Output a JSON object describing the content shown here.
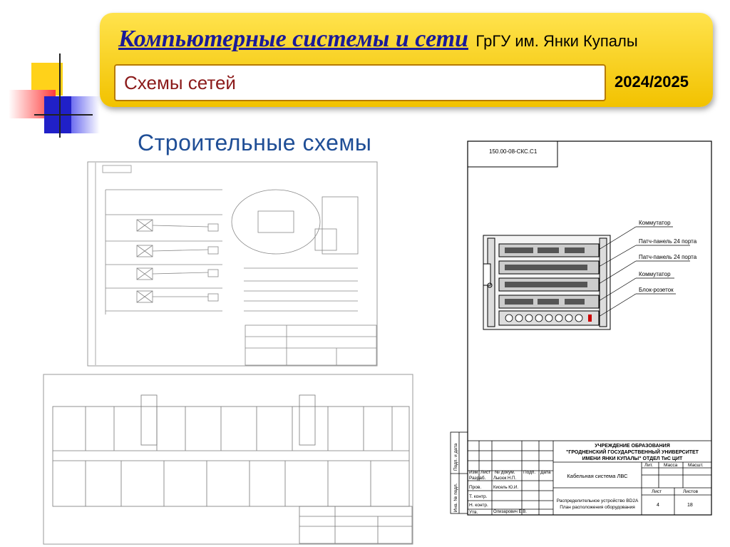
{
  "header": {
    "course_title": "Компьютерные системы и сети",
    "university": "ГрГУ им. Янки Купалы",
    "topic": "Схемы сетей",
    "year": "2024/2025"
  },
  "slide": {
    "title": "Строительные схемы"
  },
  "rack_drawing": {
    "doc_code": "150.00-08-СКС.С1",
    "callouts": [
      "Коммутатор",
      "Патч-панель 24 порта",
      "Патч-панель 24 порта",
      "Коммутатор",
      "Блок-розеток"
    ],
    "stamp": {
      "org_line1": "УЧРЕЖДЕНИЕ ОБРАЗОВАНИЯ",
      "org_line2": "\"ГРОДНЕНСКИЙ ГОСУДАРСТВЕННЫЙ УНИВЕРСИТЕТ",
      "org_line3": "ИМЕНИ ЯНКИ КУПАЛЫ\" ОТДЕЛ ТиС ЦИТ",
      "h_izm": "Изм",
      "h_list": "Лист",
      "h_doc": "№ докум.",
      "h_sign": "Подп.",
      "h_date": "Дата",
      "r_razrab": "Разраб.",
      "r_razrab_name": "Лысюк Н.П.",
      "r_prov": "Пров.",
      "r_prov_name": "Кисель Ю.И.",
      "r_tkontr": "Т. контр.",
      "r_nkontr": "Н. контр.",
      "r_utv": "Утв.",
      "r_utv_name": "Олизарович Е.В.",
      "system": "Кабельная система ЛВС",
      "desc1": "Распределительное устройство BD2A",
      "desc2": "План расположения оборудования",
      "lit": "Лит.",
      "mass": "Масса",
      "scale": "Масшт.",
      "sheet": "Лист",
      "sheets": "Листов",
      "sheet_num": "4",
      "sheets_num": "18",
      "side1": "Подп. и дата",
      "side2": "Инв. № подл."
    }
  }
}
